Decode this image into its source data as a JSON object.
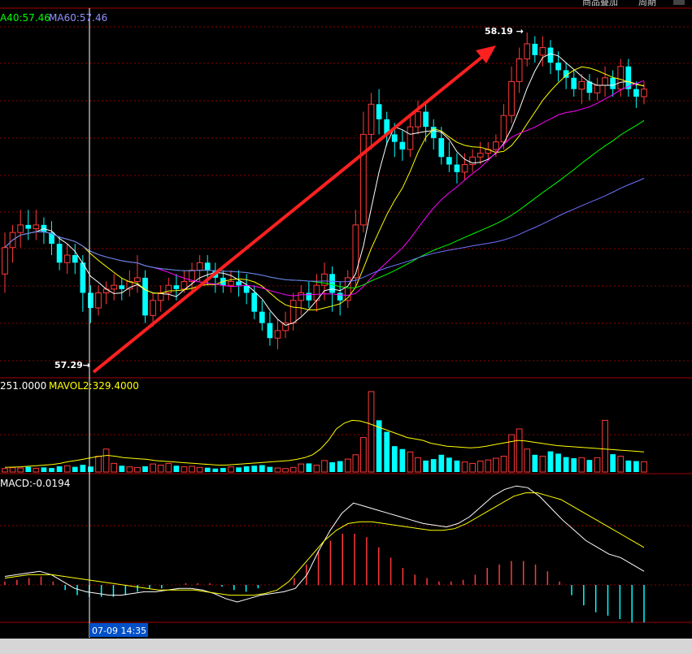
{
  "toolbar": {
    "btn1": "商品叠加",
    "btn2": "周期"
  },
  "legends": {
    "ma40": "A40:57.46",
    "ma60": "MA60:57.46",
    "vol": "251.0000",
    "mavol": "MAVOL2:329.4000",
    "macd": "MACD:-0.0194"
  },
  "annotations": {
    "high": "58.19",
    "low": "57.29",
    "cursor_time": "07-09 14:35"
  },
  "colors": {
    "up": "#ff3a3a",
    "down": "#00ffff",
    "ma_white": "#ffffff",
    "ma_yellow": "#ffff00",
    "ma_magenta": "#ff00ff",
    "ma_green": "#00ff00",
    "ma_blue": "#7070ff",
    "arrow": "#ff2020",
    "grid": "#8b0000"
  },
  "chart_data": {
    "type": "candlestick",
    "y_range": [
      57.29,
      58.19
    ],
    "candles": [
      [
        57.55,
        57.62,
        57.5,
        57.66
      ],
      [
        57.62,
        57.66,
        57.58,
        57.68
      ],
      [
        57.66,
        57.68,
        57.62,
        57.72
      ],
      [
        57.68,
        57.67,
        57.64,
        57.72
      ],
      [
        57.67,
        57.68,
        57.64,
        57.72
      ],
      [
        57.68,
        57.66,
        57.63,
        57.7
      ],
      [
        57.66,
        57.63,
        57.6,
        57.69
      ],
      [
        57.63,
        57.58,
        57.56,
        57.65
      ],
      [
        57.58,
        57.6,
        57.55,
        57.63
      ],
      [
        57.6,
        57.58,
        57.55,
        57.63
      ],
      [
        57.58,
        57.5,
        57.45,
        57.6
      ],
      [
        57.5,
        57.46,
        57.42,
        57.52
      ],
      [
        57.46,
        57.5,
        57.44,
        57.52
      ],
      [
        57.5,
        57.51,
        57.47,
        57.53
      ],
      [
        57.51,
        57.52,
        57.48,
        57.55
      ],
      [
        57.52,
        57.51,
        57.48,
        57.54
      ],
      [
        57.51,
        57.53,
        57.49,
        57.56
      ],
      [
        57.53,
        57.54,
        57.5,
        57.6
      ],
      [
        57.54,
        57.44,
        57.42,
        57.56
      ],
      [
        57.44,
        57.48,
        57.41,
        57.5
      ],
      [
        57.48,
        57.5,
        57.45,
        57.52
      ],
      [
        57.5,
        57.52,
        57.48,
        57.54
      ],
      [
        57.52,
        57.51,
        57.48,
        57.55
      ],
      [
        57.51,
        57.53,
        57.5,
        57.56
      ],
      [
        57.53,
        57.56,
        57.5,
        57.58
      ],
      [
        57.56,
        57.58,
        57.53,
        57.6
      ],
      [
        57.58,
        57.56,
        57.52,
        57.6
      ],
      [
        57.56,
        57.54,
        57.5,
        57.58
      ],
      [
        57.54,
        57.52,
        57.5,
        57.56
      ],
      [
        57.52,
        57.53,
        57.5,
        57.56
      ],
      [
        57.53,
        57.52,
        57.49,
        57.56
      ],
      [
        57.52,
        57.5,
        57.47,
        57.55
      ],
      [
        57.5,
        57.45,
        57.43,
        57.52
      ],
      [
        57.45,
        57.42,
        57.4,
        57.48
      ],
      [
        57.42,
        57.38,
        57.36,
        57.45
      ],
      [
        57.38,
        57.4,
        57.35,
        57.43
      ],
      [
        57.4,
        57.42,
        57.38,
        57.45
      ],
      [
        57.42,
        57.48,
        57.4,
        57.5
      ],
      [
        57.48,
        57.5,
        57.44,
        57.52
      ],
      [
        57.5,
        57.48,
        57.46,
        57.53
      ],
      [
        57.48,
        57.52,
        57.45,
        57.55
      ],
      [
        57.52,
        57.55,
        57.48,
        57.58
      ],
      [
        57.55,
        57.5,
        57.45,
        57.57
      ],
      [
        57.5,
        57.48,
        57.44,
        57.53
      ],
      [
        57.48,
        57.54,
        57.46,
        57.56
      ],
      [
        57.54,
        57.68,
        57.52,
        57.72
      ],
      [
        57.68,
        57.92,
        57.66,
        57.98
      ],
      [
        57.92,
        58.0,
        57.88,
        58.03
      ],
      [
        58.0,
        57.96,
        57.92,
        58.04
      ],
      [
        57.96,
        57.92,
        57.89,
        57.98
      ],
      [
        57.92,
        57.9,
        57.86,
        57.95
      ],
      [
        57.9,
        57.88,
        57.85,
        57.93
      ],
      [
        57.88,
        57.94,
        57.86,
        57.97
      ],
      [
        57.94,
        57.98,
        57.92,
        58.01
      ],
      [
        57.98,
        57.94,
        57.9,
        58.0
      ],
      [
        57.94,
        57.91,
        57.88,
        57.96
      ],
      [
        57.91,
        57.86,
        57.84,
        57.94
      ],
      [
        57.86,
        57.84,
        57.82,
        57.9
      ],
      [
        57.84,
        57.82,
        57.79,
        57.87
      ],
      [
        57.82,
        57.84,
        57.8,
        57.87
      ],
      [
        57.84,
        57.86,
        57.82,
        57.88
      ],
      [
        57.86,
        57.87,
        57.84,
        57.9
      ],
      [
        57.87,
        57.88,
        57.85,
        57.9
      ],
      [
        57.88,
        57.9,
        57.86,
        57.92
      ],
      [
        57.9,
        57.97,
        57.88,
        58.0
      ],
      [
        57.97,
        58.06,
        57.95,
        58.1
      ],
      [
        58.06,
        58.12,
        58.03,
        58.15
      ],
      [
        58.12,
        58.16,
        58.1,
        58.19
      ],
      [
        58.16,
        58.13,
        58.11,
        58.18
      ],
      [
        58.13,
        58.15,
        58.1,
        58.18
      ],
      [
        58.15,
        58.11,
        58.08,
        58.17
      ],
      [
        58.11,
        58.09,
        58.06,
        58.14
      ],
      [
        58.09,
        58.07,
        58.04,
        58.11
      ],
      [
        58.07,
        58.04,
        58.02,
        58.09
      ],
      [
        58.04,
        58.06,
        58.0,
        58.08
      ],
      [
        58.06,
        58.03,
        58.01,
        58.08
      ],
      [
        58.03,
        58.05,
        58.01,
        58.07
      ],
      [
        58.05,
        58.07,
        58.02,
        58.1
      ],
      [
        58.07,
        58.04,
        58.02,
        58.09
      ],
      [
        58.04,
        58.1,
        58.02,
        58.12
      ],
      [
        58.1,
        58.04,
        58.02,
        58.12
      ],
      [
        58.04,
        58.02,
        57.99,
        58.06
      ],
      [
        58.02,
        58.04,
        58.0,
        58.06
      ]
    ],
    "volume": [
      12,
      15,
      14,
      18,
      13,
      16,
      14,
      20,
      22,
      18,
      25,
      19,
      55,
      80,
      30,
      22,
      18,
      16,
      20,
      28,
      24,
      30,
      22,
      18,
      20,
      16,
      15,
      12,
      14,
      18,
      16,
      20,
      22,
      24,
      18,
      14,
      12,
      16,
      28,
      30,
      24,
      40,
      34,
      38,
      45,
      60,
      120,
      280,
      180,
      140,
      90,
      80,
      70,
      50,
      40,
      45,
      60,
      50,
      40,
      35,
      30,
      38,
      42,
      48,
      55,
      130,
      150,
      80,
      60,
      55,
      72,
      64,
      52,
      48,
      50,
      42,
      50,
      180,
      62,
      55,
      40,
      38,
      36
    ],
    "mavol": [
      16,
      17,
      18,
      20,
      22,
      24,
      26,
      30,
      36,
      40,
      45,
      50,
      55,
      58,
      55,
      50,
      48,
      46,
      44,
      40,
      38,
      36,
      34,
      32,
      30,
      28,
      26,
      24,
      24,
      26,
      28,
      30,
      32,
      34,
      36,
      38,
      40,
      44,
      50,
      60,
      80,
      110,
      150,
      170,
      180,
      178,
      170,
      160,
      150,
      140,
      130,
      120,
      115,
      110,
      100,
      95,
      90,
      88,
      86,
      84,
      86,
      90,
      95,
      100,
      105,
      110,
      108,
      104,
      100,
      96,
      92,
      90,
      88,
      86,
      84,
      82,
      80,
      78,
      76,
      74,
      72,
      70
    ],
    "macd_dif": [
      0.05,
      0.06,
      0.07,
      0.08,
      0.06,
      0.02,
      -0.02,
      -0.04,
      -0.05,
      -0.06,
      -0.06,
      -0.05,
      -0.04,
      -0.04,
      -0.03,
      -0.02,
      -0.02,
      -0.03,
      -0.05,
      -0.08,
      -0.1,
      -0.08,
      -0.06,
      -0.05,
      -0.04,
      -0.02,
      0.06,
      0.2,
      0.32,
      0.42,
      0.48,
      0.46,
      0.44,
      0.42,
      0.4,
      0.38,
      0.36,
      0.35,
      0.34,
      0.36,
      0.4,
      0.46,
      0.52,
      0.56,
      0.58,
      0.57,
      0.52,
      0.45,
      0.38,
      0.32,
      0.26,
      0.22,
      0.18,
      0.16,
      0.12,
      0.08
    ],
    "macd_dea": [
      0.04,
      0.05,
      0.06,
      0.06,
      0.06,
      0.05,
      0.04,
      0.03,
      0.02,
      0.01,
      0.0,
      -0.01,
      -0.02,
      -0.03,
      -0.03,
      -0.03,
      -0.03,
      -0.04,
      -0.05,
      -0.06,
      -0.06,
      -0.06,
      -0.05,
      -0.03,
      0.02,
      0.1,
      0.18,
      0.26,
      0.32,
      0.36,
      0.37,
      0.37,
      0.36,
      0.35,
      0.34,
      0.33,
      0.32,
      0.32,
      0.33,
      0.36,
      0.4,
      0.44,
      0.48,
      0.52,
      0.54,
      0.54,
      0.52,
      0.5,
      0.46,
      0.42,
      0.38,
      0.34,
      0.3,
      0.26,
      0.22
    ],
    "macd_hist": [
      0.02,
      0.03,
      0.04,
      0.05,
      0.02,
      -0.03,
      -0.06,
      -0.07,
      -0.07,
      -0.07,
      -0.06,
      -0.04,
      -0.02,
      -0.02,
      0.0,
      0.01,
      0.01,
      0.01,
      -0.01,
      -0.03,
      -0.04,
      -0.02,
      0.0,
      0.0,
      0.04,
      0.12,
      0.2,
      0.26,
      0.3,
      0.3,
      0.28,
      0.22,
      0.16,
      0.1,
      0.06,
      0.04,
      0.02,
      0.02,
      0.03,
      0.06,
      0.1,
      0.12,
      0.14,
      0.14,
      0.12,
      0.08,
      0.02,
      -0.06,
      -0.12,
      -0.16,
      -0.18,
      -0.2,
      -0.22,
      -0.22
    ]
  }
}
